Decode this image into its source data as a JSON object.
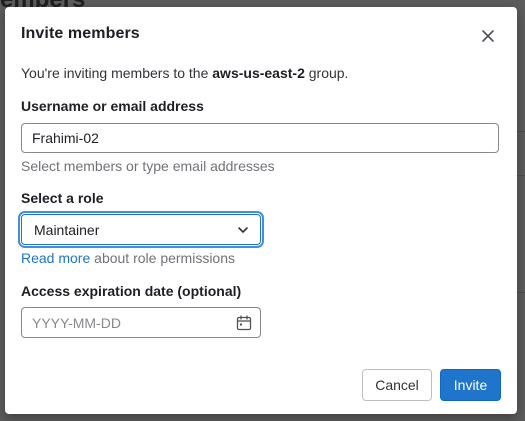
{
  "background": {
    "page_title_fragment": "embers"
  },
  "modal": {
    "title": "Invite members",
    "intro_prefix": "You're inviting members to the ",
    "group_name": "aws-us-east-2",
    "intro_suffix": " group.",
    "username_label": "Username or email address",
    "username_value": "Frahimi-02",
    "username_help": "Select members or type email addresses",
    "role_label": "Select a role",
    "role_selected": "Maintainer",
    "read_more_link": "Read more",
    "read_more_suffix": " about role permissions",
    "expiration_label": "Access expiration date (optional)",
    "expiration_placeholder": "YYYY-MM-DD",
    "cancel_label": "Cancel",
    "invite_label": "Invite"
  },
  "colors": {
    "primary": "#1f75cb",
    "overlay": "#5d5d5d"
  }
}
